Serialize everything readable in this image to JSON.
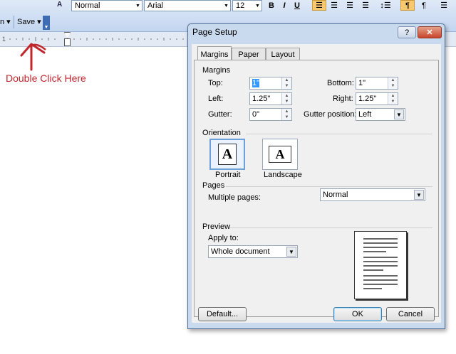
{
  "toolbar": {
    "partial_left": "n",
    "style_value": "Normal",
    "font_value": "Arial",
    "size_value": "12",
    "save_label": "Save"
  },
  "annotation": {
    "text": "Double Click Here",
    "color": "#c0272d"
  },
  "dialog": {
    "title": "Page Setup",
    "tabs": [
      "Margins",
      "Paper",
      "Layout"
    ],
    "active_tab": "Margins",
    "margins": {
      "heading": "Margins",
      "top_label": "Top:",
      "top_value": "1\"",
      "bottom_label": "Bottom:",
      "bottom_value": "1\"",
      "left_label": "Left:",
      "left_value": "1.25\"",
      "right_label": "Right:",
      "right_value": "1.25\"",
      "gutter_label": "Gutter:",
      "gutter_value": "0\"",
      "gutter_position_label": "Gutter position:",
      "gutter_position_value": "Left"
    },
    "orientation": {
      "heading": "Orientation",
      "portrait_label": "Portrait",
      "landscape_label": "Landscape",
      "glyph": "A",
      "selected": "Portrait"
    },
    "pages": {
      "heading": "Pages",
      "multiple_label": "Multiple pages:",
      "multiple_value": "Normal"
    },
    "preview": {
      "heading": "Preview",
      "apply_label": "Apply to:",
      "apply_value": "Whole document"
    },
    "buttons": {
      "default": "Default...",
      "ok": "OK",
      "cancel": "Cancel"
    }
  }
}
